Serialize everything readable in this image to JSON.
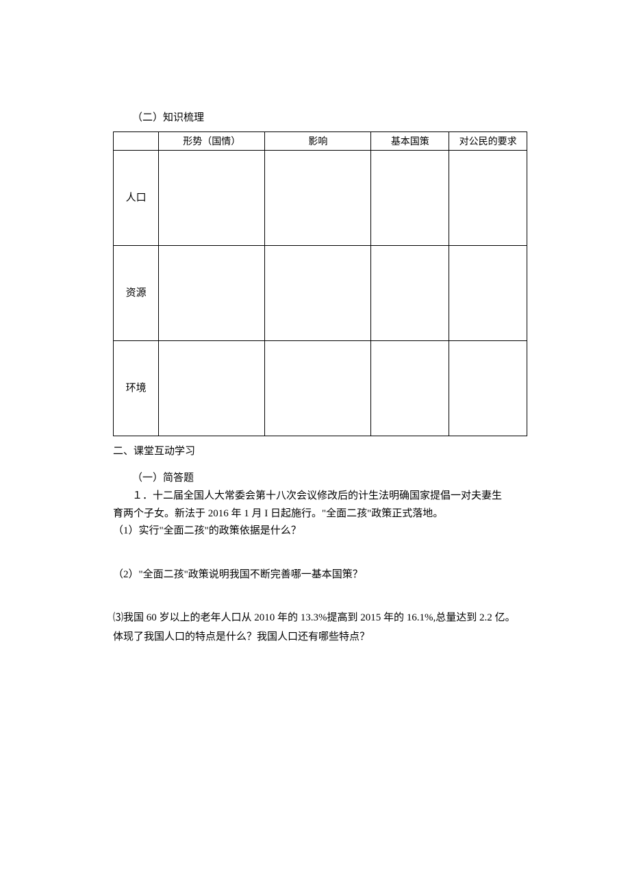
{
  "headers": {
    "knowledge": "（二）知识梳理",
    "section2": "二、课堂互动学习",
    "short_answer": "（一）简答题"
  },
  "table": {
    "cols": [
      "",
      "形势（国情）",
      "影响",
      "基本国策",
      "对公民的要求"
    ],
    "rows": [
      {
        "label": "人口",
        "cells": [
          "",
          "",
          "",
          ""
        ]
      },
      {
        "label": "资源",
        "cells": [
          "",
          "",
          "",
          ""
        ]
      },
      {
        "label": "环境",
        "cells": [
          "",
          "",
          "",
          ""
        ]
      }
    ]
  },
  "q1": {
    "stem_line1": "１．十二届全国人大常委会第十八次会议修改后的计生法明确国家提倡一对夫妻生",
    "stem_line2": "育两个子女。新法于 2016 年 1 月 I 日起施行。\"全面二孩\"政策正式落地。",
    "sub1": "（1）实行\"全面二孩\"的政策依据是什么？",
    "sub2": "（2）\"全面二孩\"政策说明我国不断完善哪一基本国策？",
    "sub3_line1": "⑶我国 60 岁以上的老年人口从 2010 年的 13.3%提高到 2015 年的 16.1%,总量达到 2.2 亿。",
    "sub3_line2": "体现了我国人口的特点是什么？我国人口还有哪些特点？"
  }
}
